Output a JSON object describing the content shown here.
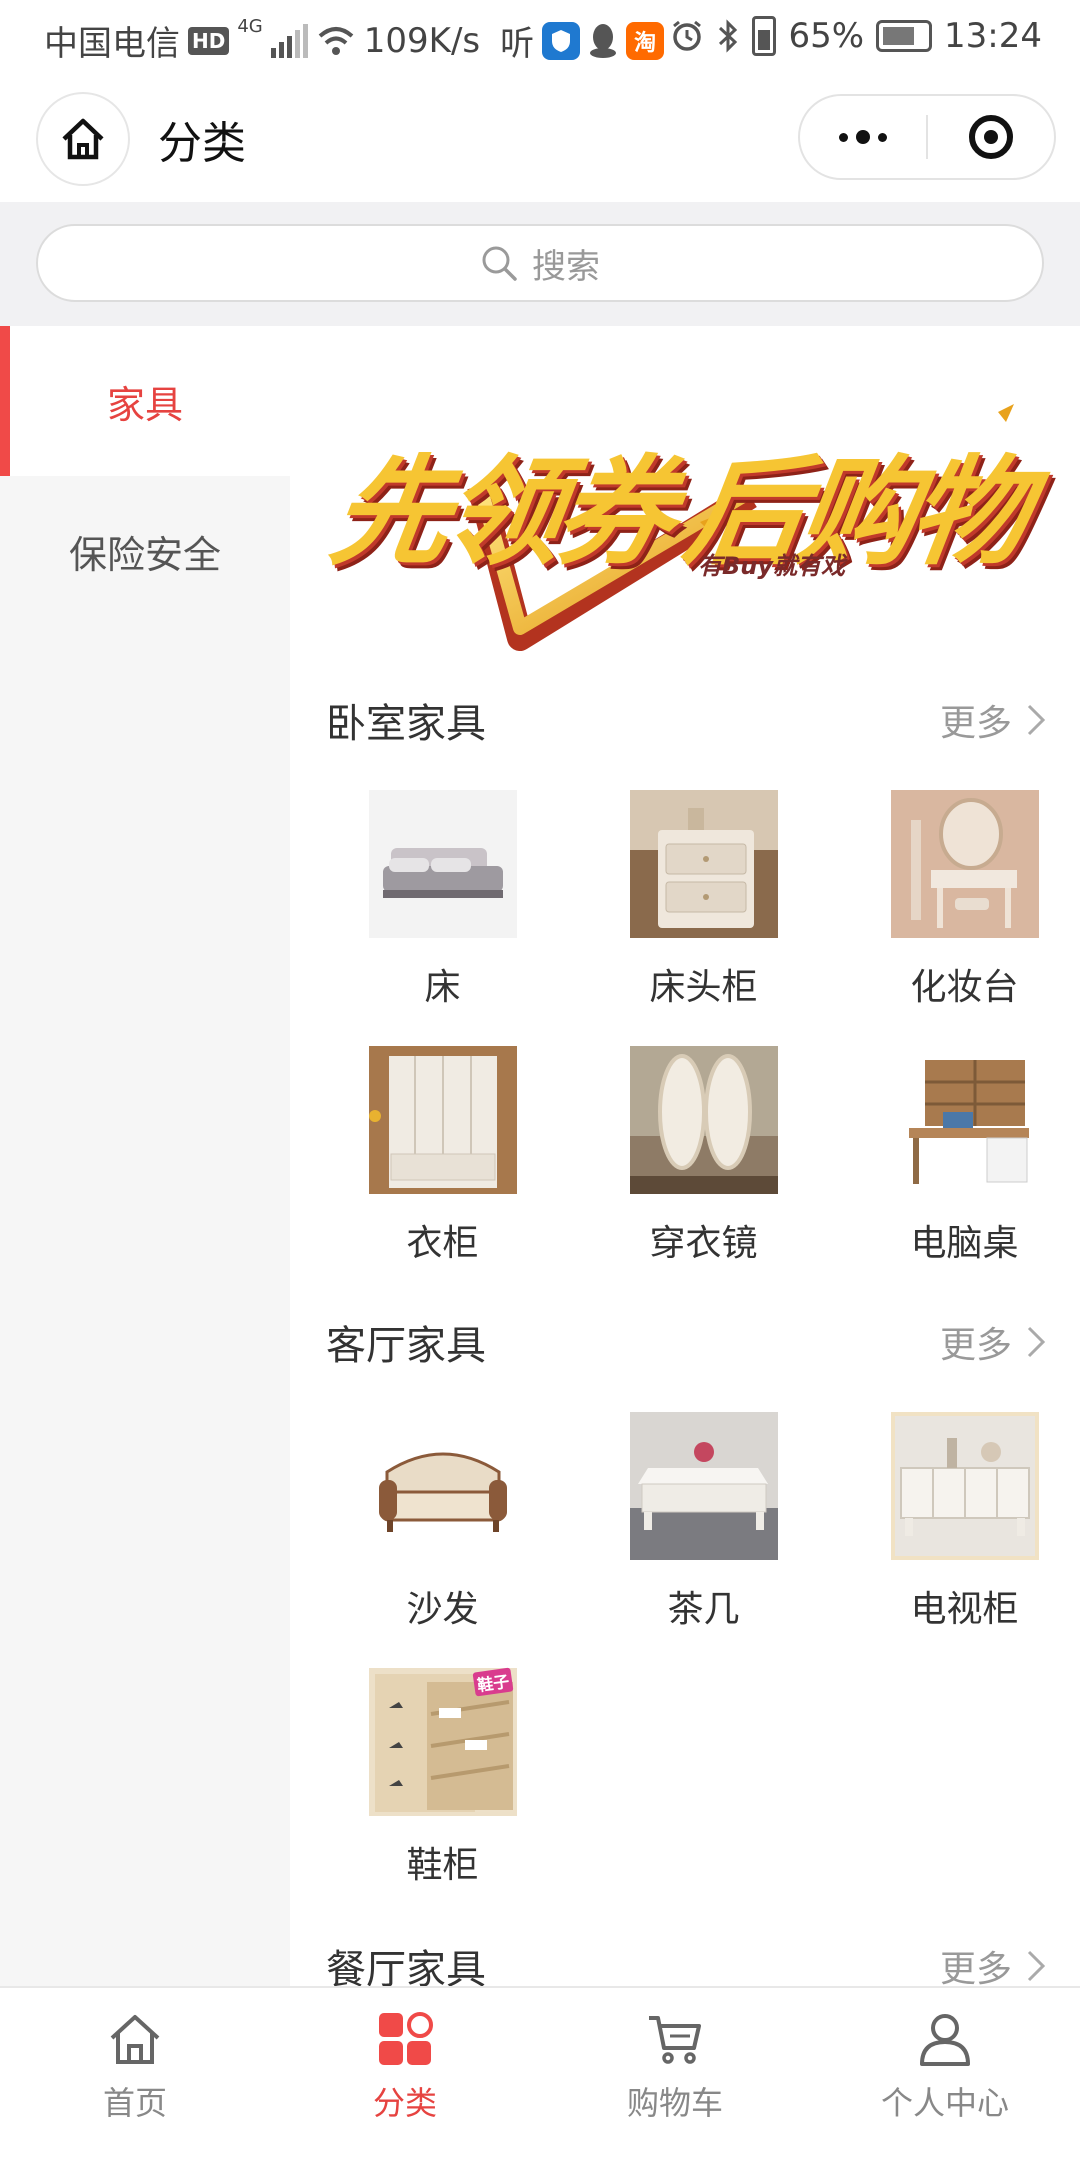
{
  "status_bar": {
    "carrier": "中国电信",
    "hd": "HD",
    "net": "4G",
    "speed": "109K/s",
    "listen": "听",
    "tao": "淘",
    "battery": "65%",
    "time": "13:24"
  },
  "nav": {
    "title": "分类"
  },
  "search": {
    "placeholder": "搜索"
  },
  "sidebar": {
    "items": [
      {
        "label": "家具",
        "active": true
      },
      {
        "label": "保险安全",
        "active": false
      }
    ]
  },
  "banner": {
    "headline_left": "先领券",
    "headline_right": "后购物",
    "tagline": "有Buy就有戏"
  },
  "sections": [
    {
      "title": "卧室家具",
      "more": "更多",
      "items": [
        {
          "name": "床",
          "icon": "bed-image"
        },
        {
          "name": "床头柜",
          "icon": "nightstand-image"
        },
        {
          "name": "化妆台",
          "icon": "dressing-table-image"
        },
        {
          "name": "衣柜",
          "icon": "wardrobe-image"
        },
        {
          "name": "穿衣镜",
          "icon": "mirror-image"
        },
        {
          "name": "电脑桌",
          "icon": "computer-desk-image"
        }
      ]
    },
    {
      "title": "客厅家具",
      "more": "更多",
      "items": [
        {
          "name": "沙发",
          "icon": "sofa-image"
        },
        {
          "name": "茶几",
          "icon": "coffee-table-image"
        },
        {
          "name": "电视柜",
          "icon": "tv-cabinet-image"
        },
        {
          "name": "鞋柜",
          "icon": "shoe-cabinet-image",
          "badge": "鞋子"
        }
      ]
    },
    {
      "title": "餐厅家具",
      "more": "更多",
      "items": []
    }
  ],
  "tabbar": {
    "tabs": [
      {
        "label": "首页",
        "icon": "home-icon",
        "active": false
      },
      {
        "label": "分类",
        "icon": "category-icon",
        "active": true
      },
      {
        "label": "购物车",
        "icon": "cart-icon",
        "active": false
      },
      {
        "label": "个人中心",
        "icon": "user-icon",
        "active": false
      }
    ]
  },
  "colors": {
    "accent": "#e64340",
    "sidebar_bg": "#f6f6f6",
    "search_bg": "#f1f1f3",
    "muted_text": "#999999"
  }
}
